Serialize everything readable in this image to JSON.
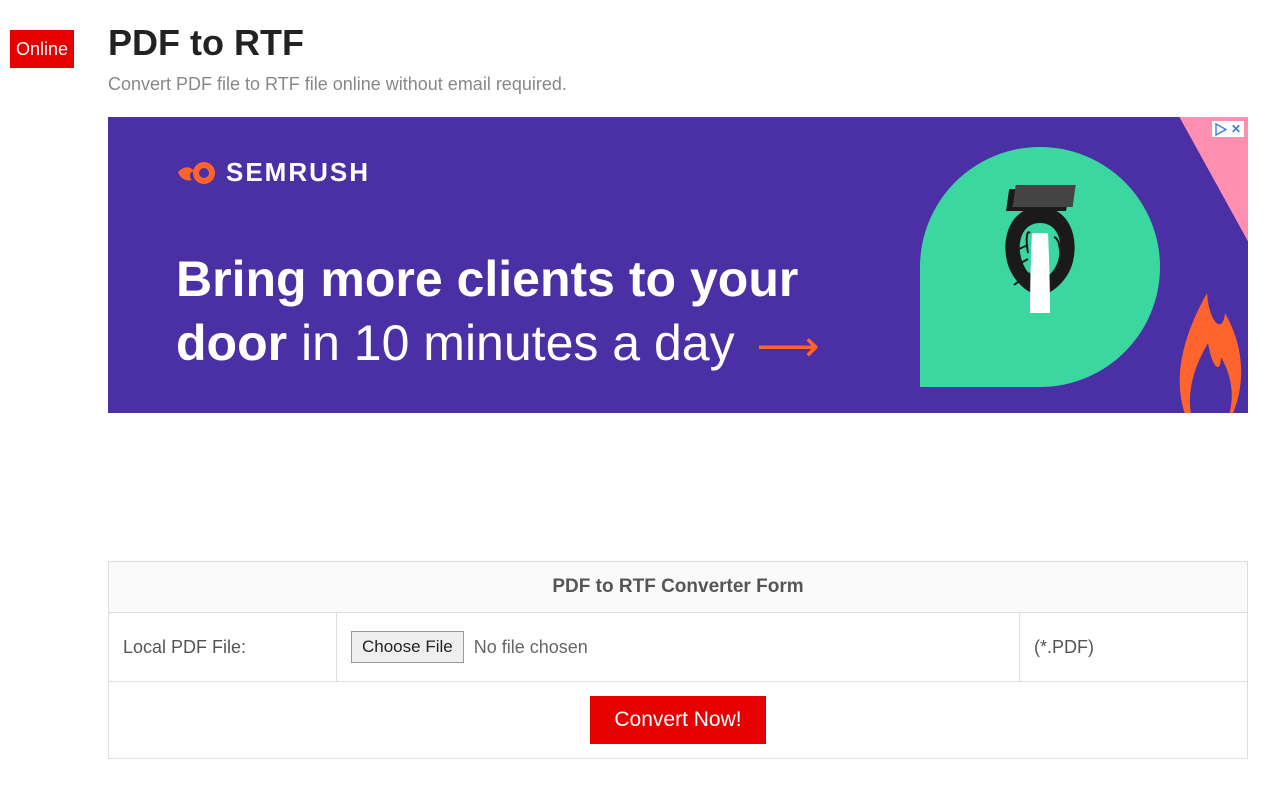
{
  "badge": "Online",
  "page": {
    "title": "PDF to RTF",
    "subtitle": "Convert PDF file to RTF file online without email required."
  },
  "ad": {
    "brand": "SEMRUSH",
    "headline_bold1": "Bring more clients to your",
    "headline_bold2": "door",
    "headline_rest": " in 10 minutes a day"
  },
  "form": {
    "header": "PDF to RTF Converter Form",
    "row_label": "Local PDF File:",
    "choose_button": "Choose File",
    "no_file": "No file chosen",
    "extension": "(*.PDF)",
    "submit": "Convert Now!"
  }
}
